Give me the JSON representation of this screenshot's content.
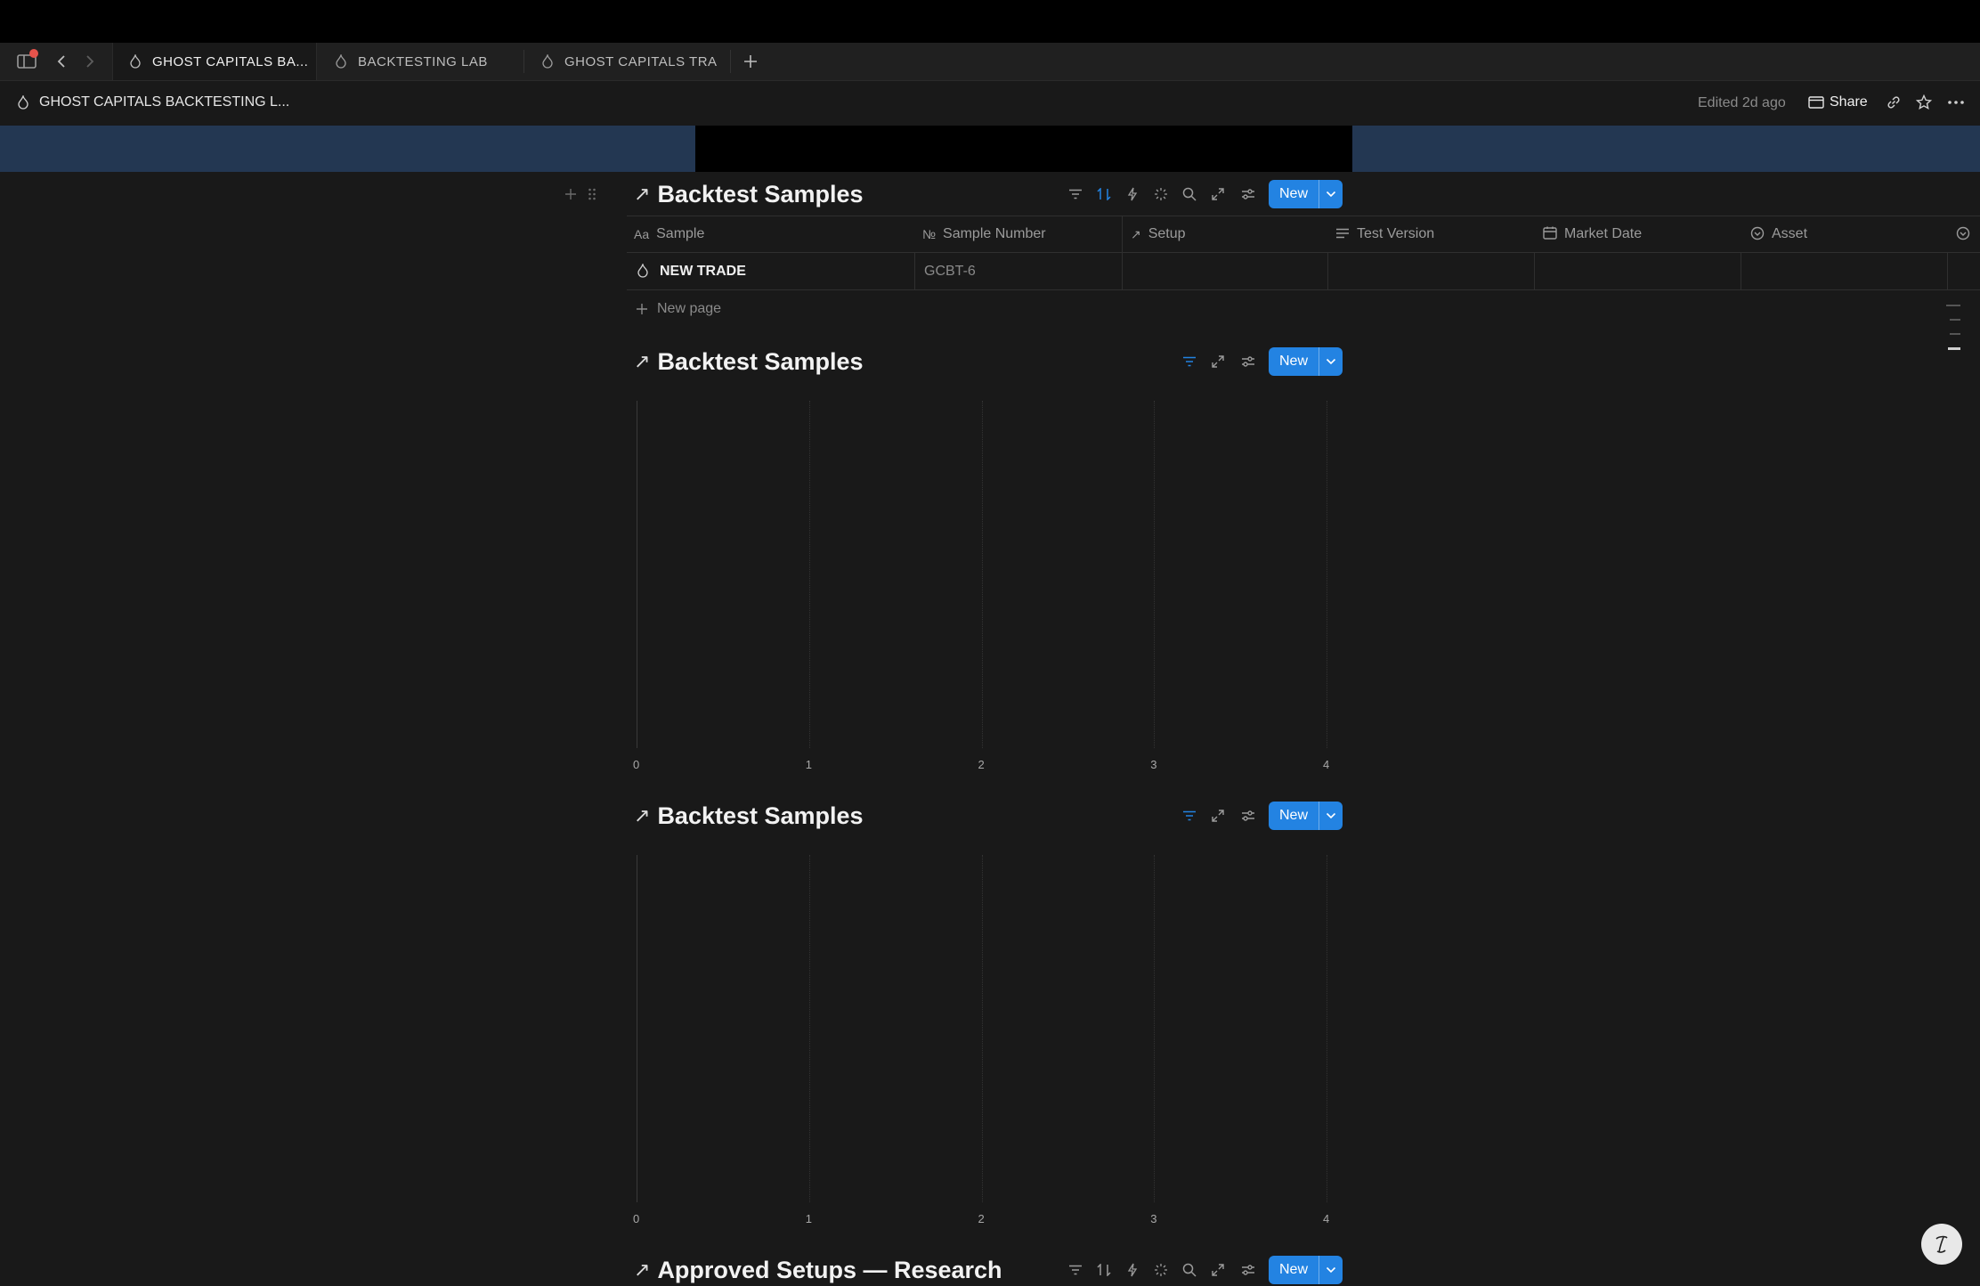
{
  "tabs": [
    {
      "label": "GHOST CAPITALS BA...",
      "active": true
    },
    {
      "label": "BACKTESTING LAB",
      "active": false
    },
    {
      "label": "GHOST CAPITALS TRA",
      "active": false
    }
  ],
  "header": {
    "breadcrumb": "GHOST CAPITALS BACKTESTING L...",
    "edited": "Edited 2d ago",
    "share": "Share"
  },
  "table_section": {
    "title": "Backtest Samples",
    "new_label": "New",
    "columns": [
      {
        "icon": "Aa",
        "label": "Sample"
      },
      {
        "icon": "№",
        "label": "Sample Number"
      },
      {
        "icon": "↗",
        "label": "Setup"
      },
      {
        "icon": "≡",
        "label": "Test Version"
      },
      {
        "icon": "calendar",
        "label": "Market Date"
      },
      {
        "icon": "select",
        "label": "Asset"
      }
    ],
    "rows": [
      {
        "sample": "NEW TRADE",
        "number": "GCBT-6",
        "setup": "",
        "version": "",
        "date": "",
        "asset": ""
      }
    ],
    "new_page": "New page"
  },
  "chart_sections": [
    {
      "title": "Backtest Samples",
      "new_label": "New"
    },
    {
      "title": "Backtest Samples",
      "new_label": "New"
    }
  ],
  "chart_data": [
    {
      "type": "bar",
      "categories": [],
      "values": [],
      "xlim": [
        0,
        4
      ],
      "xticks": [
        "0",
        "1",
        "2",
        "3",
        "4"
      ],
      "grid": true
    },
    {
      "type": "bar",
      "categories": [],
      "values": [],
      "xlim": [
        0,
        4
      ],
      "xticks": [
        "0",
        "1",
        "2",
        "3",
        "4"
      ],
      "grid": true
    }
  ],
  "bottom_section": {
    "title": "Approved Setups — Research",
    "new_label": "New"
  },
  "colors": {
    "accent": "#2383e2",
    "cover": "#233752",
    "background": "#191919",
    "notification": "#e5534b"
  }
}
